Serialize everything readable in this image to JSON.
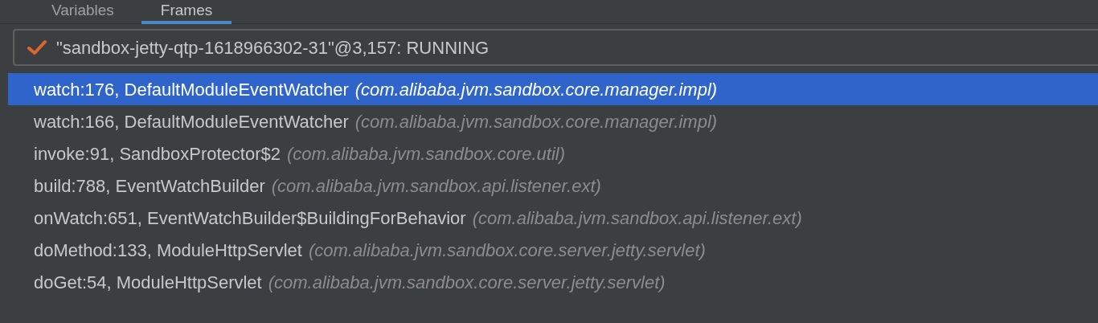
{
  "tabs": [
    {
      "label": "Variables",
      "selected": false
    },
    {
      "label": "Frames",
      "selected": true
    }
  ],
  "thread_selector": {
    "checked": true,
    "value": "\"sandbox-jetty-qtp-1618966302-31\"@3,157: RUNNING"
  },
  "frames": [
    {
      "method": "watch:176, DefaultModuleEventWatcher",
      "package": "(com.alibaba.jvm.sandbox.core.manager.impl)",
      "selected": true
    },
    {
      "method": "watch:166, DefaultModuleEventWatcher",
      "package": "(com.alibaba.jvm.sandbox.core.manager.impl)",
      "selected": false
    },
    {
      "method": "invoke:91, SandboxProtector$2",
      "package": "(com.alibaba.jvm.sandbox.core.util)",
      "selected": false
    },
    {
      "method": "build:788, EventWatchBuilder",
      "package": "(com.alibaba.jvm.sandbox.api.listener.ext)",
      "selected": false
    },
    {
      "method": "onWatch:651, EventWatchBuilder$BuildingForBehavior",
      "package": "(com.alibaba.jvm.sandbox.api.listener.ext)",
      "selected": false
    },
    {
      "method": "doMethod:133, ModuleHttpServlet",
      "package": "(com.alibaba.jvm.sandbox.core.server.jetty.servlet)",
      "selected": false
    },
    {
      "method": "doGet:54, ModuleHttpServlet",
      "package": "(com.alibaba.jvm.sandbox.core.server.jetty.servlet)",
      "selected": false
    }
  ]
}
